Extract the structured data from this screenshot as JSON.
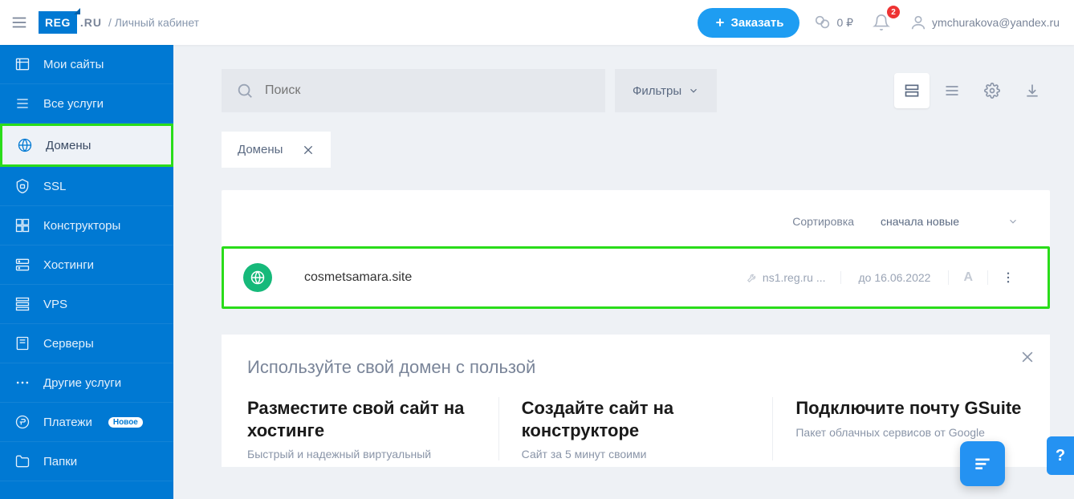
{
  "header": {
    "breadcrumb": "/ Личный кабинет",
    "order_btn": "Заказать",
    "balance": "0 ₽",
    "notif_count": "2",
    "user_email": "ymchurakova@yandex.ru"
  },
  "sidebar": {
    "items": [
      {
        "label": "Мои сайты"
      },
      {
        "label": "Все услуги"
      },
      {
        "label": "Домены"
      },
      {
        "label": "SSL"
      },
      {
        "label": "Конструкторы"
      },
      {
        "label": "Хостинги"
      },
      {
        "label": "VPS"
      },
      {
        "label": "Серверы"
      },
      {
        "label": "Другие услуги"
      },
      {
        "label": "Платежи",
        "pill": "Новое"
      },
      {
        "label": "Папки"
      }
    ]
  },
  "search": {
    "placeholder": "Поиск"
  },
  "filters_label": "Фильтры",
  "chip_label": "Домены",
  "sort": {
    "label": "Сортировка",
    "value": "сначала новые"
  },
  "domain": {
    "name": "cosmetsamara.site",
    "ns": "ns1.reg.ru ...",
    "expires_prefix": "до ",
    "expires_date": "16.06.2022",
    "record_type": "A"
  },
  "promo": {
    "heading": "Используйте свой домен с пользой",
    "cols": [
      {
        "title": "Разместите свой сайт на хостинге",
        "desc": "Быстрый и надежный виртуальный"
      },
      {
        "title": "Создайте сайт на конструкторе",
        "desc": "Сайт за 5 минут своими"
      },
      {
        "title": "Подключите почту GSuite",
        "desc": "Пакет облачных сервисов от Google"
      }
    ]
  },
  "help_label": "?"
}
